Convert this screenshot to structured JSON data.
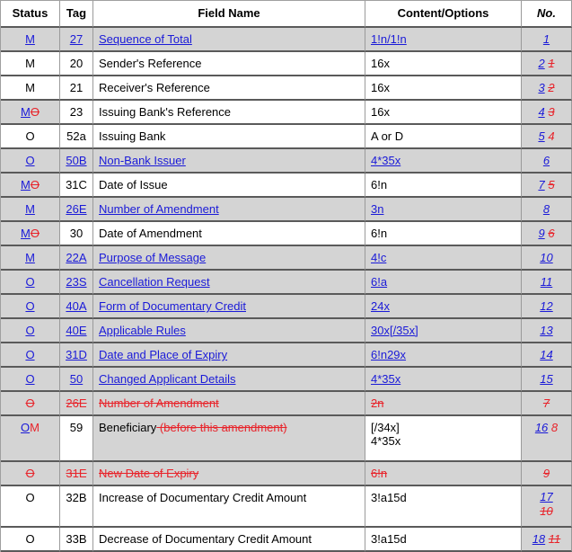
{
  "headers": {
    "status": "Status",
    "tag": "Tag",
    "field_name": "Field Name",
    "content": "Content/Options",
    "no": "No."
  },
  "colors": {
    "link": "#1a1ad8",
    "deleted": "#e8232a",
    "changed_background": "#d4d4d4"
  },
  "rows": [
    {
      "status_new": "M",
      "tag": "27",
      "field_name": "Sequence of Total",
      "content": "1!n/1!n",
      "no_new": "1",
      "kind": "new-link"
    },
    {
      "status": "M",
      "tag": "20",
      "field_name": "Sender's Reference",
      "content": "16x",
      "no_new": "2",
      "no_old": "1"
    },
    {
      "status": "M",
      "tag": "21",
      "field_name": "Receiver's Reference",
      "content": "16x",
      "no_new": "3",
      "no_old": "2"
    },
    {
      "status_new": "M",
      "status_old": "O",
      "tag": "23",
      "field_name": "Issuing Bank's Reference",
      "content": "16x",
      "no_new": "4",
      "no_old": "3"
    },
    {
      "status": "O",
      "tag": "52a",
      "field_name": "Issuing Bank",
      "content": "A or D",
      "no_new": "5",
      "no_old": "4"
    },
    {
      "status_new": "O",
      "tag": "50B",
      "field_name": "Non-Bank Issuer",
      "content": "4*35x",
      "no_new": "6",
      "kind": "new-link"
    },
    {
      "status_new": "M",
      "status_old": "O",
      "tag": "31C",
      "field_name": "Date of Issue",
      "content": "6!n",
      "no_new": "7",
      "no_old": "5"
    },
    {
      "status_new": "M",
      "tag": "26E",
      "field_name": "Number of Amendment",
      "content": "3n",
      "no_new": "8",
      "kind": "new-link"
    },
    {
      "status_new": "M",
      "status_old": "O",
      "tag": "30",
      "field_name": "Date of Amendment",
      "content": "6!n",
      "no_new": "9",
      "no_old": "6"
    },
    {
      "status_new": "M",
      "tag": "22A",
      "field_name": "Purpose of Message",
      "content": "4!c",
      "no_new": "10",
      "kind": "new-link"
    },
    {
      "status_new": "O",
      "tag": "23S",
      "field_name": "Cancellation Request",
      "content": "6!a",
      "no_new": "11",
      "kind": "new-link"
    },
    {
      "status_new": "O",
      "tag": "40A",
      "field_name": "Form of Documentary Credit",
      "content": "24x",
      "no_new": "12",
      "kind": "new-link"
    },
    {
      "status_new": "O",
      "tag": "40E",
      "field_name": "Applicable Rules",
      "content": "30x[/35x]",
      "no_new": "13",
      "kind": "new-link"
    },
    {
      "status_new": "O",
      "tag": "31D",
      "field_name": "Date and Place of Expiry",
      "content": "6!n29x",
      "no_new": "14",
      "kind": "new-link"
    },
    {
      "status_new": "O",
      "tag": "50",
      "field_name": "Changed Applicant Details",
      "content": "4*35x",
      "no_new": "15",
      "kind": "new-link"
    },
    {
      "status_old": "O",
      "tag": "26E",
      "field_name": "Number of Amendment",
      "content": "2n",
      "no_old": "7",
      "kind": "deleted"
    },
    {
      "status_new": "O",
      "status_old": "M",
      "tag": "59",
      "field_name": "Beneficiary",
      "field_name_deleted": " (before this amendment)",
      "content_lines": [
        "[/34x]",
        "4*35x"
      ],
      "no_new": "16",
      "no_old": "8"
    },
    {
      "status_old": "O",
      "tag": "31E",
      "field_name": "New Date of Expiry",
      "content": "6!n",
      "no_old": "9",
      "kind": "deleted"
    },
    {
      "status": "O",
      "tag": "32B",
      "field_name": "Increase of Documentary Credit Amount",
      "content": "3!a15d",
      "no_new": "17",
      "no_old": "10"
    },
    {
      "status": "O",
      "tag": "33B",
      "field_name": "Decrease of Documentary Credit Amount",
      "content": "3!a15d",
      "no_new": "18",
      "no_old": "11"
    }
  ]
}
